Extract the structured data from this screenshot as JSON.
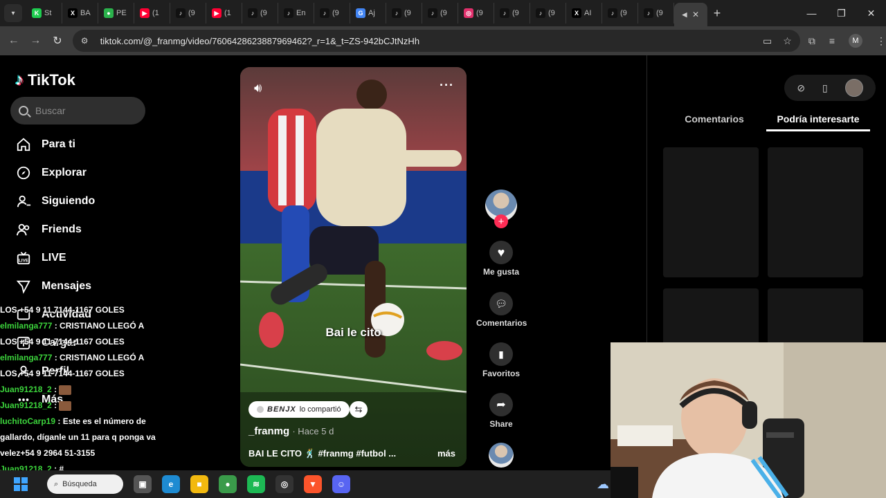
{
  "browser": {
    "tabs": [
      {
        "label": "St",
        "icon": "kick-icon",
        "color": "#1ecc4f",
        "glyph": "K"
      },
      {
        "label": "BA",
        "icon": "x-icon",
        "color": "#000000",
        "glyph": "X"
      },
      {
        "label": "PE",
        "icon": "green-app-icon",
        "color": "#2bb24c",
        "glyph": "●"
      },
      {
        "label": "(1",
        "icon": "youtube-icon",
        "color": "#ff0033",
        "glyph": "▶"
      },
      {
        "label": "(9",
        "icon": "tiktok-icon",
        "color": "#111111",
        "glyph": "♪"
      },
      {
        "label": "(1",
        "icon": "youtube-icon",
        "color": "#ff0033",
        "glyph": "▶"
      },
      {
        "label": "(9",
        "icon": "tiktok-icon",
        "color": "#111111",
        "glyph": "♪"
      },
      {
        "label": "En",
        "icon": "tiktok-icon",
        "color": "#111111",
        "glyph": "♪"
      },
      {
        "label": "(9",
        "icon": "tiktok-icon",
        "color": "#111111",
        "glyph": "♪"
      },
      {
        "label": "Aj",
        "icon": "google-icon",
        "color": "#4285f4",
        "glyph": "G"
      },
      {
        "label": "(9",
        "icon": "tiktok-icon",
        "color": "#111111",
        "glyph": "♪"
      },
      {
        "label": "(9",
        "icon": "tiktok-icon",
        "color": "#111111",
        "glyph": "♪"
      },
      {
        "label": "(9",
        "icon": "instagram-icon",
        "color": "#e1306c",
        "glyph": "◎"
      },
      {
        "label": "(9",
        "icon": "tiktok-icon",
        "color": "#111111",
        "glyph": "♪"
      },
      {
        "label": "(9",
        "icon": "tiktok-icon",
        "color": "#111111",
        "glyph": "♪"
      },
      {
        "label": "AI",
        "icon": "x-icon",
        "color": "#000000",
        "glyph": "X"
      },
      {
        "label": "(9",
        "icon": "tiktok-icon",
        "color": "#111111",
        "glyph": "♪"
      },
      {
        "label": "(9",
        "icon": "tiktok-icon",
        "color": "#111111",
        "glyph": "♪"
      }
    ],
    "url": "tiktok.com/@_franmg/video/7606428623887969462?_r=1&_t=ZS-942bCJtNzHh",
    "profile_initial": "M"
  },
  "tiktok": {
    "logo": "TikTok",
    "search_placeholder": "Buscar",
    "nav": [
      {
        "label": "Para ti",
        "icon": "home-icon"
      },
      {
        "label": "Explorar",
        "icon": "compass-icon"
      },
      {
        "label": "Siguiendo",
        "icon": "following-icon"
      },
      {
        "label": "Friends",
        "icon": "friends-icon"
      },
      {
        "label": "LIVE",
        "icon": "live-icon"
      },
      {
        "label": "Mensajes",
        "icon": "messages-icon"
      },
      {
        "label": "Actividad",
        "icon": "activity-icon"
      },
      {
        "label": "Cargar",
        "icon": "upload-icon"
      },
      {
        "label": "Perfil",
        "icon": "profile-icon"
      },
      {
        "label": "Más",
        "icon": "more-icon"
      }
    ]
  },
  "chat": [
    {
      "user": "",
      "msg": "LOS +54 9 11 7144-1167 GOLES"
    },
    {
      "user": "elmilanga777",
      "msg": ": CRISTIANO LLEGÓ A"
    },
    {
      "user": "",
      "msg": "LOS +54 9 11 7144-1167 GOLES"
    },
    {
      "user": "elmilanga777",
      "msg": ": CRISTIANO LLEGÓ A"
    },
    {
      "user": "",
      "msg": "LOS +54 9 11 7144-1167 GOLES"
    },
    {
      "user": "Juan91218_2",
      "msg": ":"
    },
    {
      "user": "Juan91218_2",
      "msg": ":"
    },
    {
      "user": "luchitoCarp19",
      "msg": ": Este es el número de"
    },
    {
      "user": "",
      "msg": "gallardo, díganle un 11 para q ponga va"
    },
    {
      "user": "",
      "msg": "velez+54 9 2964 51-3155"
    },
    {
      "user": "Juan91218_2",
      "msg": ": #"
    },
    {
      "user": "Juan91218_2",
      "msg": ":"
    },
    {
      "user": "Juan91218_2",
      "msg": ":"
    }
  ],
  "video": {
    "overlay_caption": "Bai le cito",
    "shared_by": "BENJX",
    "shared_text": "lo compartió",
    "author": "_franmg",
    "time_ago": "· Hace 5 d",
    "description": "BAI LE CITO 🕺 #franmg #futbol ...",
    "more": "más"
  },
  "actions": {
    "like": "Me gusta",
    "comments": "Comentarios",
    "favorites": "Favoritos",
    "share": "Share"
  },
  "right_panel": {
    "tab_comments": "Comentarios",
    "tab_suggestions": "Podría interesarte"
  },
  "taskbar": {
    "search_label": "Búsqueda",
    "apps": [
      {
        "name": "task-view-icon",
        "color": "#555555",
        "glyph": "▣"
      },
      {
        "name": "edge-icon",
        "color": "#1e8bd2",
        "glyph": "e"
      },
      {
        "name": "file-explorer-icon",
        "color": "#f2b90f",
        "glyph": "■"
      },
      {
        "name": "chrome-icon",
        "color": "#3a9b4a",
        "glyph": "●"
      },
      {
        "name": "spotify-icon",
        "color": "#1db954",
        "glyph": "≋"
      },
      {
        "name": "obs-icon",
        "color": "#333333",
        "glyph": "◎"
      },
      {
        "name": "brave-icon",
        "color": "#fb542b",
        "glyph": "▼"
      },
      {
        "name": "discord-icon",
        "color": "#5865f2",
        "glyph": "☺"
      }
    ]
  }
}
